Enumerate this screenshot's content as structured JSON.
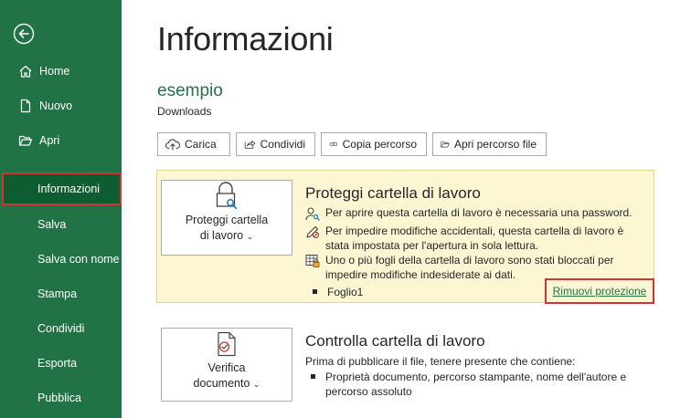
{
  "sidebar": {
    "items": [
      {
        "label": "Home",
        "icon": "home-icon"
      },
      {
        "label": "Nuovo",
        "icon": "new-file-icon"
      },
      {
        "label": "Apri",
        "icon": "open-folder-icon"
      },
      {
        "label": "Informazioni",
        "active": true
      },
      {
        "label": "Salva"
      },
      {
        "label": "Salva con nome"
      },
      {
        "label": "Stampa"
      },
      {
        "label": "Condividi"
      },
      {
        "label": "Esporta"
      },
      {
        "label": "Pubblica"
      }
    ]
  },
  "page": {
    "title": "Informazioni",
    "file_name": "esempio",
    "file_path": "Downloads"
  },
  "actions": [
    {
      "label": "Carica",
      "icon": "upload-cloud-icon"
    },
    {
      "label": "Condividi",
      "icon": "share-icon"
    },
    {
      "label": "Copia percorso",
      "icon": "link-icon"
    },
    {
      "label": "Apri percorso file",
      "icon": "folder-icon"
    }
  ],
  "protect": {
    "button_line1": "Proteggi cartella",
    "button_line2": "di lavoro",
    "title": "Proteggi cartella di lavoro",
    "lines": [
      "Per aprire questa cartella di lavoro è necessaria una password.",
      "Per impedire modifiche accidentali, questa cartella di lavoro è stata impostata per l'apertura in sola lettura.",
      "Uno o più fogli della cartella di lavoro sono stati bloccati per impedire modifiche indesiderate ai dati."
    ],
    "sheet": "Foglio1",
    "remove_link": "Rimuovi protezione"
  },
  "check": {
    "button_line1": "Verifica",
    "button_line2": "documento",
    "title": "Controlla cartella di lavoro",
    "intro": "Prima di pubblicare il file, tenere presente che contiene:",
    "bullet": "Proprietà documento, percorso stampante, nome dell'autore e percorso assoluto"
  },
  "colors": {
    "sidebar_bg": "#217346",
    "sidebar_active": "#0e5c2f",
    "highlight_border": "#d13438",
    "panel_bg": "#fdf6d3",
    "accent_text": "#217346"
  }
}
